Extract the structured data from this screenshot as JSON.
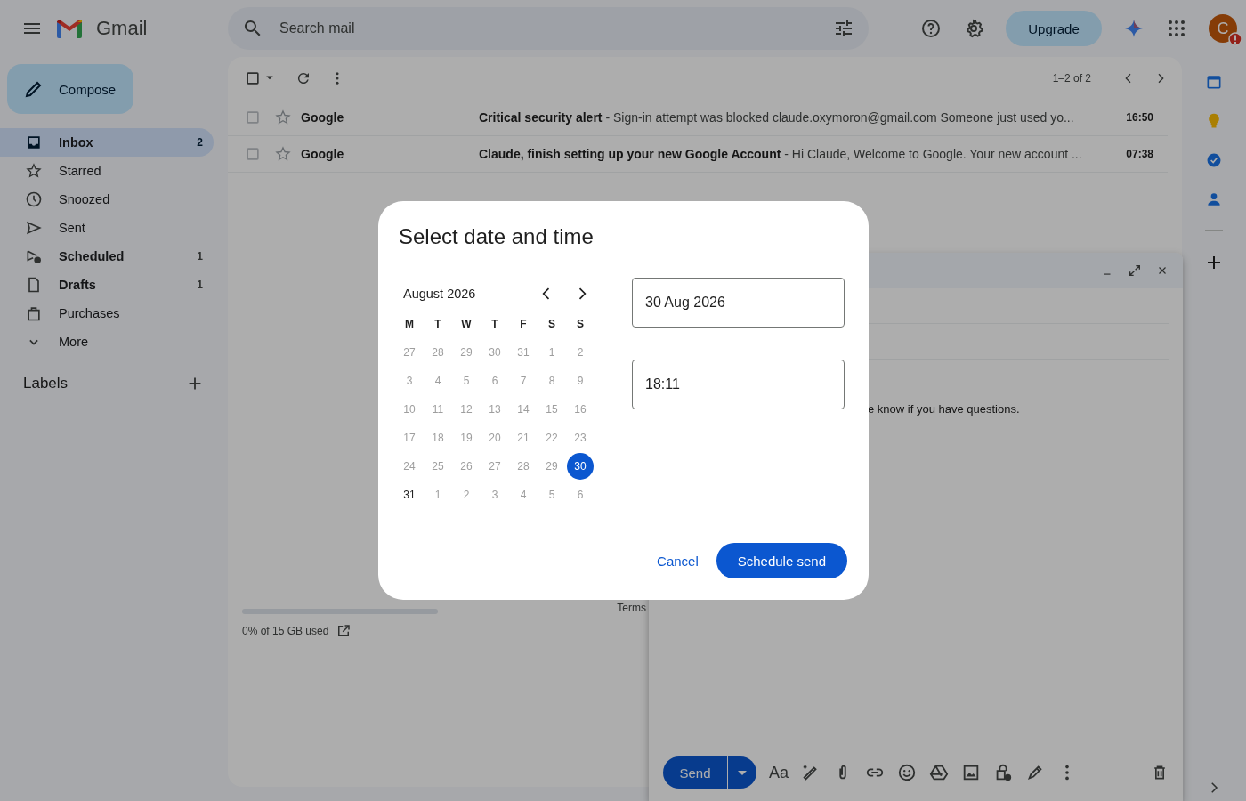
{
  "app": {
    "name": "Gmail"
  },
  "search": {
    "placeholder": "Search mail"
  },
  "header": {
    "upgrade": "Upgrade",
    "avatar": "C"
  },
  "compose_button": "Compose",
  "sidebar": {
    "items": [
      {
        "label": "Inbox",
        "count": "2",
        "bold": true,
        "selected": true
      },
      {
        "label": "Starred",
        "bold": false,
        "selected": false
      },
      {
        "label": "Snoozed",
        "bold": false,
        "selected": false
      },
      {
        "label": "Sent",
        "bold": false,
        "selected": false
      },
      {
        "label": "Scheduled",
        "count": "1",
        "bold": true,
        "selected": false
      },
      {
        "label": "Drafts",
        "count": "1",
        "bold": true,
        "selected": false
      },
      {
        "label": "Purchases",
        "bold": false,
        "selected": false
      },
      {
        "label": "More",
        "bold": false,
        "selected": false
      }
    ],
    "labels_heading": "Labels"
  },
  "toolbar": {
    "range": "1–2 of 2"
  },
  "emails": [
    {
      "sender": "Google",
      "subject": "Critical security alert",
      "snippet": " - Sign-in attempt was blocked claude.oxymoron@gmail.com Someone just used yo...",
      "time": "16:50",
      "unread": true,
      "starred": false,
      "checked": false
    },
    {
      "sender": "Google",
      "subject": "Claude, finish setting up your new Google Account",
      "snippet": " - Hi Claude, Welcome to Google. Your new account ...",
      "time": "07:38",
      "unread": true,
      "starred": false,
      "checked": false
    }
  ],
  "storage": {
    "text": "0% of 15 GB used",
    "level": 0
  },
  "footer": {
    "terms": "Terms"
  },
  "compose": {
    "body": "e know if you have questions.",
    "send": "Send",
    "format": "Aa"
  },
  "dialog": {
    "title": "Select date and time",
    "month": "August 2026",
    "weekdays": [
      "M",
      "T",
      "W",
      "T",
      "F",
      "S",
      "S"
    ],
    "weeks": [
      [
        {
          "label": "27",
          "enabled": false,
          "selected": false
        },
        {
          "label": "28",
          "enabled": false,
          "selected": false
        },
        {
          "label": "29",
          "enabled": false,
          "selected": false
        },
        {
          "label": "30",
          "enabled": false,
          "selected": false
        },
        {
          "label": "31",
          "enabled": false,
          "selected": false
        },
        {
          "label": "1",
          "enabled": false,
          "selected": false
        },
        {
          "label": "2",
          "enabled": false,
          "selected": false
        }
      ],
      [
        {
          "label": "3",
          "enabled": false,
          "selected": false
        },
        {
          "label": "4",
          "enabled": false,
          "selected": false
        },
        {
          "label": "5",
          "enabled": false,
          "selected": false
        },
        {
          "label": "6",
          "enabled": false,
          "selected": false
        },
        {
          "label": "7",
          "enabled": false,
          "selected": false
        },
        {
          "label": "8",
          "enabled": false,
          "selected": false
        },
        {
          "label": "9",
          "enabled": false,
          "selected": false
        }
      ],
      [
        {
          "label": "10",
          "enabled": false,
          "selected": false
        },
        {
          "label": "11",
          "enabled": false,
          "selected": false
        },
        {
          "label": "12",
          "enabled": false,
          "selected": false
        },
        {
          "label": "13",
          "enabled": false,
          "selected": false
        },
        {
          "label": "14",
          "enabled": false,
          "selected": false
        },
        {
          "label": "15",
          "enabled": false,
          "selected": false
        },
        {
          "label": "16",
          "enabled": false,
          "selected": false
        }
      ],
      [
        {
          "label": "17",
          "enabled": false,
          "selected": false
        },
        {
          "label": "18",
          "enabled": false,
          "selected": false
        },
        {
          "label": "19",
          "enabled": false,
          "selected": false
        },
        {
          "label": "20",
          "enabled": false,
          "selected": false
        },
        {
          "label": "21",
          "enabled": false,
          "selected": false
        },
        {
          "label": "22",
          "enabled": false,
          "selected": false
        },
        {
          "label": "23",
          "enabled": false,
          "selected": false
        }
      ],
      [
        {
          "label": "24",
          "enabled": false,
          "selected": false
        },
        {
          "label": "25",
          "enabled": false,
          "selected": false
        },
        {
          "label": "26",
          "enabled": false,
          "selected": false
        },
        {
          "label": "27",
          "enabled": false,
          "selected": false
        },
        {
          "label": "28",
          "enabled": false,
          "selected": false
        },
        {
          "label": "29",
          "enabled": false,
          "selected": false
        },
        {
          "label": "30",
          "enabled": true,
          "selected": true
        }
      ],
      [
        {
          "label": "31",
          "enabled": true,
          "selected": false
        },
        {
          "label": "1",
          "enabled": false,
          "selected": false
        },
        {
          "label": "2",
          "enabled": false,
          "selected": false
        },
        {
          "label": "3",
          "enabled": false,
          "selected": false
        },
        {
          "label": "4",
          "enabled": false,
          "selected": false
        },
        {
          "label": "5",
          "enabled": false,
          "selected": false
        },
        {
          "label": "6",
          "enabled": false,
          "selected": false
        }
      ]
    ],
    "date_value": "30 Aug 2026",
    "time_value": "18:11",
    "cancel": "Cancel",
    "confirm": "Schedule send"
  }
}
